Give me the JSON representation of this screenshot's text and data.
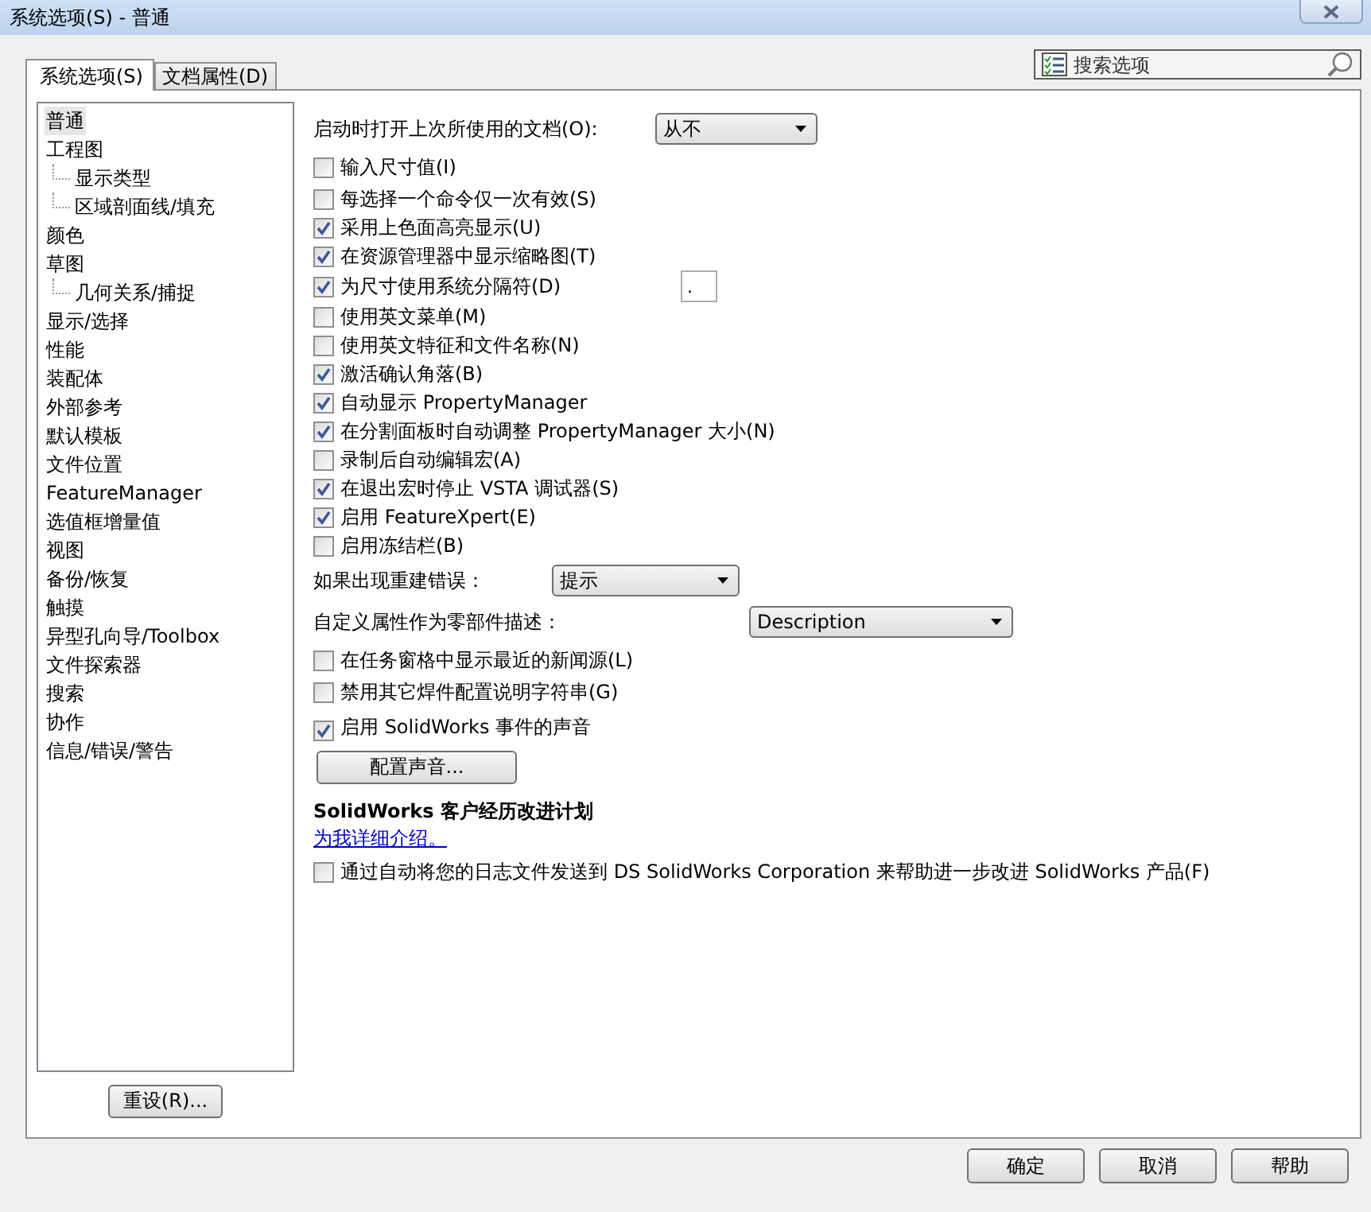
{
  "window": {
    "title": "系统选项(S) - 普通"
  },
  "tabs": [
    {
      "label": "系统选项(S)",
      "selected": true
    },
    {
      "label": "文档属性(D)",
      "selected": false
    }
  ],
  "search": {
    "placeholder": "搜索选项"
  },
  "tree": [
    {
      "label": "普通",
      "selected": true
    },
    {
      "label": "工程图",
      "selected": false,
      "children": [
        {
          "label": "显示类型",
          "selected": false
        },
        {
          "label": "区域剖面线/填充",
          "selected": false
        }
      ]
    },
    {
      "label": "颜色",
      "selected": false
    },
    {
      "label": "草图",
      "selected": false,
      "children": [
        {
          "label": "几何关系/捕捉",
          "selected": false
        }
      ]
    },
    {
      "label": "显示/选择",
      "selected": false
    },
    {
      "label": "性能",
      "selected": false
    },
    {
      "label": "装配体",
      "selected": false
    },
    {
      "label": "外部参考",
      "selected": false
    },
    {
      "label": "默认模板",
      "selected": false
    },
    {
      "label": "文件位置",
      "selected": false
    },
    {
      "label": "FeatureManager",
      "selected": false
    },
    {
      "label": "选值框增量值",
      "selected": false
    },
    {
      "label": "视图",
      "selected": false
    },
    {
      "label": "备份/恢复",
      "selected": false
    },
    {
      "label": "触摸",
      "selected": false
    },
    {
      "label": "异型孔向导/Toolbox",
      "selected": false
    },
    {
      "label": "文件探索器",
      "selected": false
    },
    {
      "label": "搜索",
      "selected": false
    },
    {
      "label": "协作",
      "selected": false
    },
    {
      "label": "信息/错误/警告",
      "selected": false
    }
  ],
  "reset_button": "重设(R)...",
  "options": [
    {
      "kind": "dropdown",
      "label": "启动时打开上次所使用的文档(O):",
      "value": "从不"
    },
    {
      "kind": "checkbox",
      "label": "输入尺寸值(I)",
      "checked": false
    },
    {
      "kind": "checkbox",
      "label": "每选择一个命令仅一次有效(S)",
      "checked": false
    },
    {
      "kind": "checkbox",
      "label": "采用上色面高亮显示(U)",
      "checked": true
    },
    {
      "kind": "checkbox",
      "label": "在资源管理器中显示缩略图(T)",
      "checked": true
    },
    {
      "kind": "checkbox",
      "label": "为尺寸使用系统分隔符(D)",
      "checked": true,
      "field_value": "."
    },
    {
      "kind": "checkbox",
      "label": "使用英文菜单(M)",
      "checked": false
    },
    {
      "kind": "checkbox",
      "label": "使用英文特征和文件名称(N)",
      "checked": false
    },
    {
      "kind": "checkbox",
      "label": "激活确认角落(B)",
      "checked": true
    },
    {
      "kind": "checkbox",
      "label": "自动显示 PropertyManager",
      "checked": true
    },
    {
      "kind": "checkbox",
      "label": "在分割面板时自动调整 PropertyManager 大小(N)",
      "checked": true
    },
    {
      "kind": "checkbox",
      "label": "录制后自动编辑宏(A)",
      "checked": false
    },
    {
      "kind": "checkbox",
      "label": "在退出宏时停止 VSTA 调试器(S)",
      "checked": true
    },
    {
      "kind": "checkbox",
      "label": "启用 FeatureXpert(E)",
      "checked": true
    },
    {
      "kind": "checkbox",
      "label": "启用冻结栏(B)",
      "checked": false
    },
    {
      "kind": "dropdown",
      "label": "如果出现重建错误：",
      "value": "提示"
    },
    {
      "kind": "dropdown",
      "label": "自定义属性作为零部件描述：",
      "value": "Description"
    },
    {
      "kind": "checkbox",
      "label": "在任务窗格中显示最近的新闻源(L)",
      "checked": false
    },
    {
      "kind": "checkbox",
      "label": "禁用其它焊件配置说明字符串(G)",
      "checked": false
    },
    {
      "kind": "checkbox",
      "label": "启用 SolidWorks 事件的声音",
      "checked": true
    },
    {
      "kind": "button",
      "label": "配置声音..."
    },
    {
      "kind": "heading",
      "label": "SolidWorks 客户经历改进计划"
    },
    {
      "kind": "link",
      "label": "为我详细介绍。"
    },
    {
      "kind": "checkbox",
      "label": "通过自动将您的日志文件发送到 DS SolidWorks Corporation 来帮助进一步改进 SolidWorks 产品(F)",
      "checked": false
    }
  ],
  "footer_buttons": [
    "确定",
    "取消",
    "帮助"
  ]
}
